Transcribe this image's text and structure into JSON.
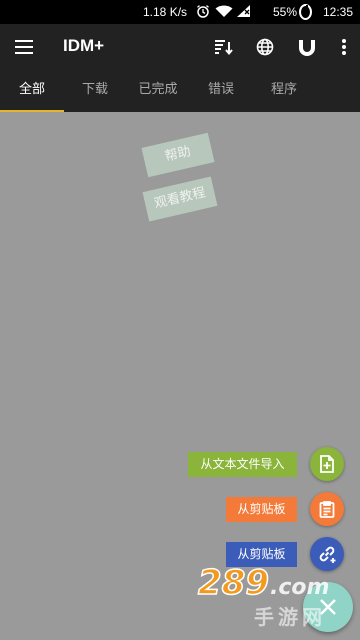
{
  "status_bar": {
    "net_speed": "1.18 K/s",
    "battery": "55%",
    "time": "12:35",
    "icons": [
      "alarm-icon",
      "wifi-icon",
      "signal-icon",
      "battery-icon"
    ]
  },
  "app_bar": {
    "title": "IDM+",
    "actions": [
      "sort-icon",
      "globe-icon",
      "magnet-icon",
      "more-icon"
    ]
  },
  "tabs": [
    {
      "label": "全部",
      "active": true
    },
    {
      "label": "下载",
      "active": false
    },
    {
      "label": "已完成",
      "active": false
    },
    {
      "label": "错误",
      "active": false
    },
    {
      "label": "程序",
      "active": false
    }
  ],
  "tab_indicator_color": "#e5b42d",
  "empty_state": {
    "help": "帮助",
    "tutorial": "观看教程"
  },
  "speed_dial": {
    "items": [
      {
        "label": "从文本文件导入",
        "icon": "file-add-icon",
        "color": "#8ab43a"
      },
      {
        "label": "从剪贴板",
        "icon": "clipboard-icon",
        "color": "#f47a39"
      },
      {
        "label": "从剪贴板",
        "icon": "link-add-icon",
        "color": "#3b5cb8"
      }
    ],
    "main_icon": "close-icon",
    "main_color": "#8fd4c7"
  },
  "watermark": {
    "logo": "289.com",
    "subtitle": "手游网"
  }
}
